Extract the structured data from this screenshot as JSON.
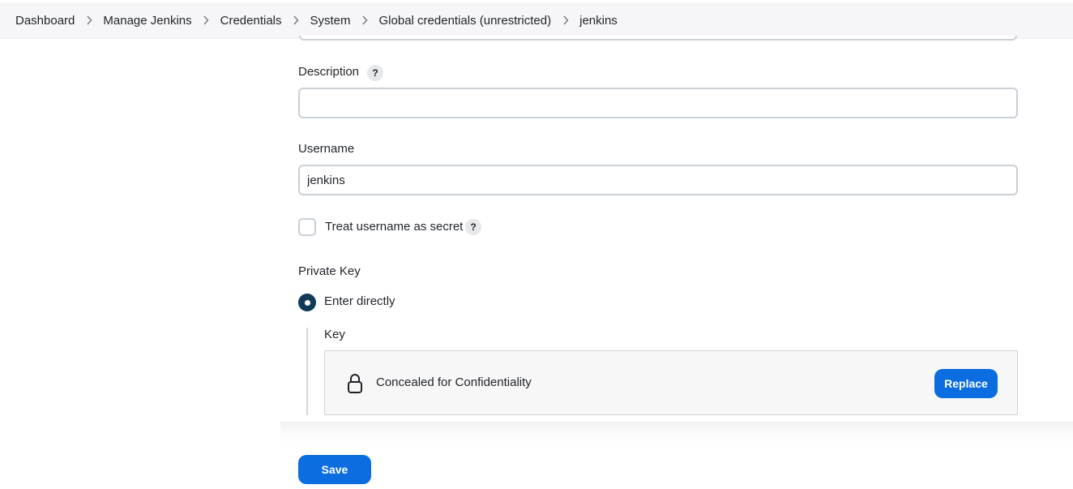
{
  "breadcrumb": {
    "items": [
      {
        "label": "Dashboard"
      },
      {
        "label": "Manage Jenkins"
      },
      {
        "label": "Credentials"
      },
      {
        "label": "System"
      },
      {
        "label": "Global credentials (unrestricted)"
      },
      {
        "label": "jenkins"
      }
    ],
    "separator_icon": "chevron-right-icon"
  },
  "form": {
    "description": {
      "label": "Description",
      "value": "",
      "help_icon": "help-icon",
      "help_text": "?"
    },
    "username": {
      "label": "Username",
      "value": "jenkins"
    },
    "treat_secret": {
      "label": "Treat username as secret",
      "checked": false,
      "help_text": "?"
    },
    "private_key": {
      "label": "Private Key",
      "option_label": "Enter directly",
      "selected": true,
      "key": {
        "label": "Key",
        "concealed_text": "Concealed for Confidentiality",
        "lock_icon": "lock-icon",
        "replace_label": "Replace"
      }
    }
  },
  "footer": {
    "save_label": "Save"
  },
  "colors": {
    "accent": "#0b6de0",
    "radio": "#0f3b57",
    "breadcrumb_bg": "#f6f6f8"
  }
}
